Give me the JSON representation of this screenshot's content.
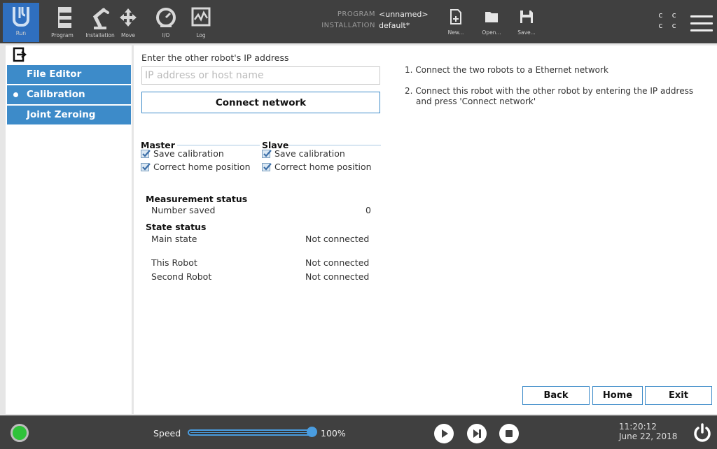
{
  "topbar": {
    "buttons": [
      {
        "label": "Run",
        "icon": "ur-logo-icon"
      },
      {
        "label": "Program",
        "icon": "program-icon"
      },
      {
        "label": "Installation",
        "icon": "robot-arm-icon"
      },
      {
        "label": "Move",
        "icon": "move-arrows-icon"
      },
      {
        "label": "I/O",
        "icon": "io-gauge-icon"
      },
      {
        "label": "Log",
        "icon": "log-chart-icon"
      }
    ],
    "program_label": "PROGRAM",
    "program_value": "<unnamed>",
    "installation_label": "INSTALLATION",
    "installation_value": "default*",
    "file_buttons": [
      {
        "label": "New...",
        "icon": "new-file-icon"
      },
      {
        "label": "Open...",
        "icon": "folder-icon"
      },
      {
        "label": "Save...",
        "icon": "save-icon"
      }
    ],
    "status_c1": "c c",
    "status_c2": "c c"
  },
  "sidebar": {
    "items": [
      {
        "label": "File Editor",
        "selected": false
      },
      {
        "label": "Calibration",
        "selected": true
      },
      {
        "label": "Joint Zeroing",
        "selected": false
      }
    ]
  },
  "main": {
    "ip_prompt": "Enter the other robot's IP address",
    "ip_placeholder": "IP address or host name",
    "ip_value": "",
    "connect_label": "Connect network",
    "master": {
      "title": "Master",
      "save_calibration": "Save calibration",
      "correct_home": "Correct home position",
      "save_checked": true,
      "home_checked": true
    },
    "slave": {
      "title": "Slave",
      "save_calibration": "Save calibration",
      "correct_home": "Correct home position",
      "save_checked": true,
      "home_checked": true
    },
    "measurement_title": "Measurement status",
    "number_saved_label": "Number saved",
    "number_saved_value": "0",
    "state_title": "State status",
    "main_state_label": "Main state",
    "main_state_value": "Not connected",
    "this_robot_label": "This Robot",
    "this_robot_value": "Not connected",
    "second_robot_label": "Second Robot",
    "second_robot_value": "Not connected",
    "instruction1": "1. Connect the two robots to a Ethernet network",
    "instruction2_line1": "2. Connect this robot with the other robot by entering the IP address",
    "instruction2_line2": "and press 'Connect network'",
    "back_label": "Back",
    "home_label": "Home",
    "exit_label": "Exit"
  },
  "bottombar": {
    "speed_label": "Speed",
    "speed_value": "100%",
    "speed_fraction": 1.0,
    "time": "11:20:12",
    "date": "June 22, 2018"
  },
  "colors": {
    "accent": "#3d8bc9",
    "topbar_bg": "#404040",
    "status_green": "#2fc23a"
  }
}
